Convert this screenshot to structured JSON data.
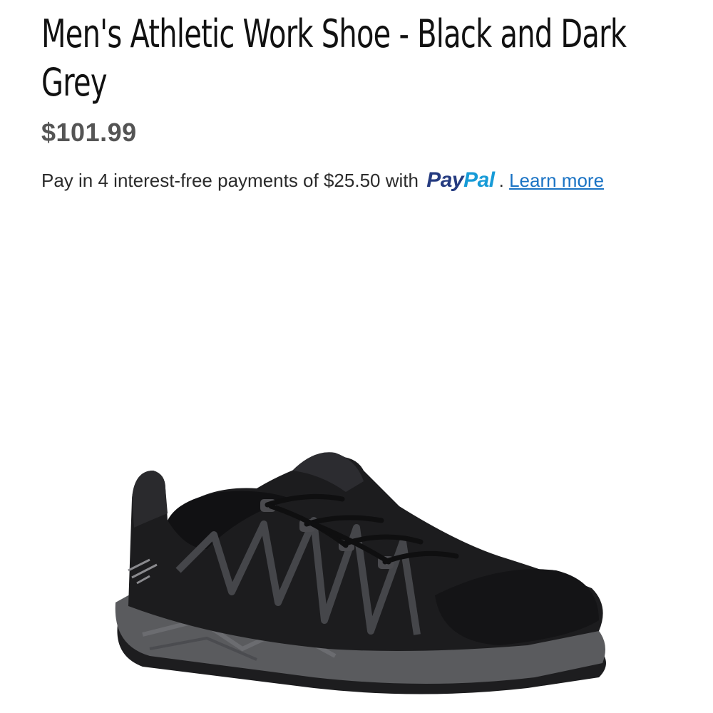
{
  "product": {
    "title": "Men's Athletic Work Shoe - Black and Dark Grey",
    "price": "$101.99"
  },
  "payment": {
    "prefix": "Pay in 4 interest-free payments of $25.50 with",
    "paypal_pay": "Pay",
    "paypal_pal": "Pal",
    "separator": ".",
    "learn_more": "Learn more",
    "paypal_colors": {
      "pay": "#253b80",
      "pal": "#179bd7"
    },
    "link_color": "#1a73c4"
  },
  "image": {
    "icon": "shoe-image",
    "colors": {
      "upper": "#1c1c1e",
      "sole": "#58595b",
      "accent": "#3e3e42"
    }
  }
}
